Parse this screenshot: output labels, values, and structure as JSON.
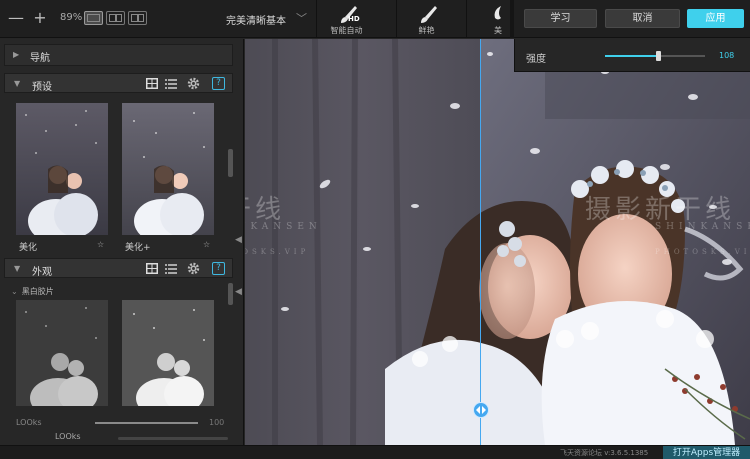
{
  "toolbar": {
    "zoom_minus": "—",
    "zoom_plus": "+",
    "zoom_level": "89%",
    "preset_name": "完美清晰基本",
    "preset_caret": "﹀",
    "tools": [
      {
        "label": "智能自动",
        "badge": "HD",
        "icon": "brush-hd-icon"
      },
      {
        "label": "鲜艳",
        "icon": "brush-icon"
      },
      {
        "label": "美",
        "icon": "brush-icon"
      }
    ],
    "learn_label": "学习",
    "cancel_label": "取消",
    "apply_label": "应用"
  },
  "strength": {
    "label": "强度",
    "value": "108",
    "level_fraction": 0.53
  },
  "left_panel": {
    "navigation_label": "导航",
    "presets": {
      "title": "预设",
      "items": [
        {
          "label": "美化",
          "star": "☆"
        },
        {
          "label": "美化+",
          "star": "☆"
        }
      ]
    },
    "appearance": {
      "title": "外观",
      "group_label": "黑白胶片",
      "group_caret": "⌄"
    },
    "looks": {
      "label": "LOOks",
      "value": "100",
      "mini_label": "LOOks",
      "level_fraction": 1.0
    },
    "help_label": "?"
  },
  "canvas": {
    "watermark_cn": "摄影新干线",
    "watermark_en": "SHINKANSEN",
    "watermark_small": "PHOTOSKS.VIP"
  },
  "status_bar": {
    "version": "飞天资源论坛 v:3.6.5.1385",
    "open_apps": "打开Apps管理器"
  },
  "colors": {
    "accent": "#3fd0ec",
    "split_line": "#45a8f0"
  }
}
